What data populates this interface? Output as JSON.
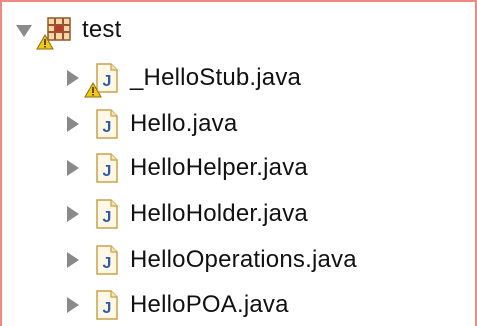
{
  "package_explorer": {
    "project": {
      "name": "test",
      "icon": "java-project-icon",
      "expanded": true,
      "has_warning": true
    },
    "files": [
      {
        "name": "_HelloStub.java",
        "icon": "java-file-icon",
        "has_warning": true
      },
      {
        "name": "Hello.java",
        "icon": "java-file-icon",
        "has_warning": false
      },
      {
        "name": "HelloHelper.java",
        "icon": "java-file-icon",
        "has_warning": false
      },
      {
        "name": "HelloHolder.java",
        "icon": "java-file-icon",
        "has_warning": false
      },
      {
        "name": "HelloOperations.java",
        "icon": "java-file-icon",
        "has_warning": false
      },
      {
        "name": "HelloPOA.java",
        "icon": "java-file-icon",
        "has_warning": false
      }
    ],
    "colors": {
      "panel_border": "#f08a80",
      "java_icon_blue": "#2f5aa8",
      "warning_yellow": "#f5c518"
    }
  }
}
